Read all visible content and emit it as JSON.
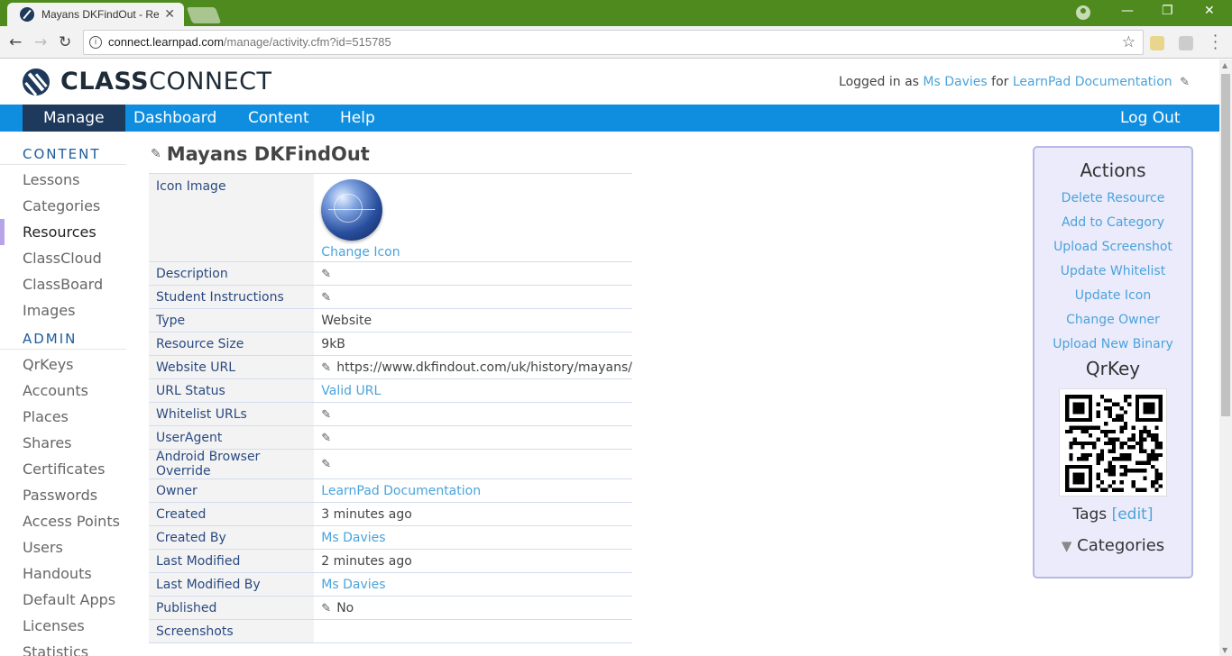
{
  "browser": {
    "tab_title": "Mayans DKFindOut - Res",
    "url_host": "connect.learnpad.com",
    "url_path": "/manage/activity.cfm?id=515785"
  },
  "header": {
    "logo_bold": "CLASS",
    "logo_light": "CONNECT",
    "login_prefix": "Logged in as",
    "login_user": "Ms Davies",
    "login_for": "for",
    "login_org": "LearnPad Documentation"
  },
  "nav": {
    "items": [
      "Manage",
      "Dashboard",
      "Content",
      "Help"
    ],
    "logout": "Log Out"
  },
  "sidebar": {
    "content_head": "CONTENT",
    "content_items": [
      "Lessons",
      "Categories",
      "Resources",
      "ClassCloud",
      "ClassBoard",
      "Images"
    ],
    "admin_head": "ADMIN",
    "admin_items": [
      "QrKeys",
      "Accounts",
      "Places",
      "Shares",
      "Certificates",
      "Passwords",
      "Access Points",
      "Users",
      "Handouts",
      "Default Apps",
      "Licenses",
      "Statistics"
    ]
  },
  "main": {
    "title": "Mayans DKFindOut",
    "change_icon": "Change Icon",
    "rows": [
      {
        "label": "Icon Image"
      },
      {
        "label": "Description",
        "value": ""
      },
      {
        "label": "Student Instructions",
        "value": ""
      },
      {
        "label": "Type",
        "value": "Website"
      },
      {
        "label": "Resource Size",
        "value": "9kB"
      },
      {
        "label": "Website URL",
        "value": "https://www.dkfindout.com/uk/history/mayans/"
      },
      {
        "label": "URL Status",
        "value": "Valid URL"
      },
      {
        "label": "Whitelist URLs",
        "value": ""
      },
      {
        "label": "UserAgent",
        "value": ""
      },
      {
        "label": "Android Browser Override",
        "value": ""
      },
      {
        "label": "Owner",
        "value": "LearnPad Documentation"
      },
      {
        "label": "Created",
        "value": "3 minutes ago"
      },
      {
        "label": "Created By",
        "value": "Ms Davies"
      },
      {
        "label": "Last Modified",
        "value": "2 minutes ago"
      },
      {
        "label": "Last Modified By",
        "value": "Ms Davies"
      },
      {
        "label": "Published",
        "value": "No"
      },
      {
        "label": "Screenshots",
        "value": ""
      }
    ]
  },
  "actions": {
    "title": "Actions",
    "links": [
      "Delete Resource",
      "Add to Category",
      "Upload Screenshot",
      "Update Whitelist",
      "Update Icon",
      "Change Owner",
      "Upload New Binary"
    ],
    "qrkey": "QrKey",
    "tags": "Tags",
    "tags_edit": "[edit]",
    "categories": "Categories"
  },
  "colors": {
    "accent": "#0f8ee0",
    "nav_active": "#1d3a5c",
    "link": "#4aa3db",
    "chrome": "#4e8a1d"
  }
}
